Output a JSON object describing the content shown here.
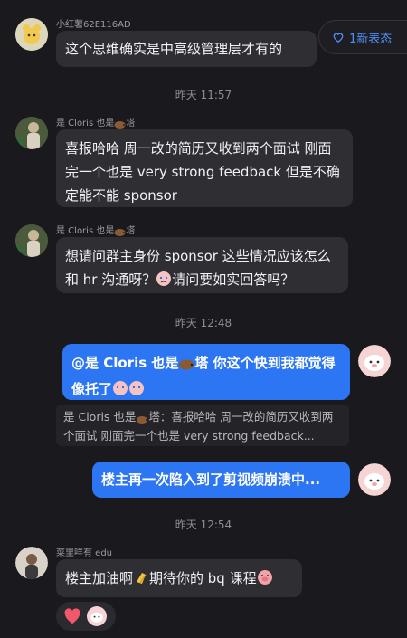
{
  "new_messages": {
    "label": "1新表态"
  },
  "messages": [
    {
      "sender": "小红薯62E116AD",
      "text": "这个思维确实是中高级管理层才有的"
    },
    {
      "sender_prefix": "是 Cloris 也是",
      "sender_suffix": "塔",
      "text": "喜报哈哈 周一改的简历又收到两个面试 刚面完一个也是 very strong feedback 但是不确定能不能 sponsor"
    },
    {
      "sender_prefix": "是 Cloris 也是",
      "sender_suffix": "塔",
      "text_a": "想请问群主身份 sponsor 这些情况应该怎么和 hr 沟通呀？",
      "text_b": "请问要如实回答吗？"
    },
    {
      "mention": "@是 Cloris 也是",
      "mention_suffix": "塔",
      "text": " 你这个快到我都觉得像托了"
    },
    {
      "text": "楼主再一次陷入到了剪视频崩溃中..."
    },
    {
      "sender": "菜里咩有 edu",
      "text_a": "楼主加油啊",
      "text_b": "期待你的 bq 课程"
    }
  ],
  "quote": {
    "text_a": "是 Cloris 也是",
    "text_b": "塔：喜报哈哈 周一改的简历又收到两个面试 刚面完一个也是 very strong feedback..."
  },
  "timestamps": [
    "昨天 11:57",
    "昨天 12:48",
    "昨天 12:54"
  ],
  "colors": {
    "background": "#1a1a1e",
    "bubble_in": "#2e2e33",
    "bubble_out": "#2c76f3",
    "accent": "#4f8df5"
  },
  "icons": [
    "heart-outline-icon",
    "hedgehog-emoji-icon",
    "crying-emoji-icon",
    "clapping-emoji-icon",
    "pig-emoji-icon",
    "heart-reaction-icon"
  ]
}
